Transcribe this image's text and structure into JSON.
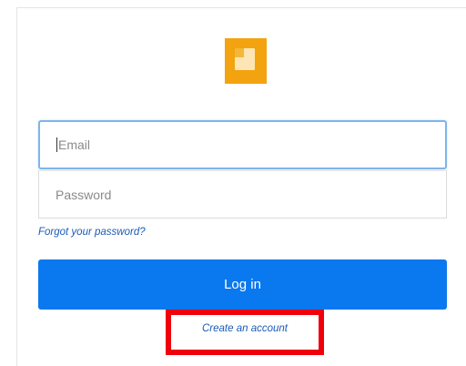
{
  "colors": {
    "logo": "#f2a30f",
    "primary_button": "#0a78ef",
    "link": "#1a5bb8",
    "highlight_box": "#f0000d",
    "focus_border": "#7fb5ea"
  },
  "logo": {
    "icon": "app-logo-icon"
  },
  "form": {
    "email": {
      "placeholder": "Email",
      "value": ""
    },
    "password": {
      "placeholder": "Password",
      "value": ""
    },
    "forgot_link": "Forgot your password?",
    "login_label": "Log in",
    "create_account_link": "Create an account"
  }
}
